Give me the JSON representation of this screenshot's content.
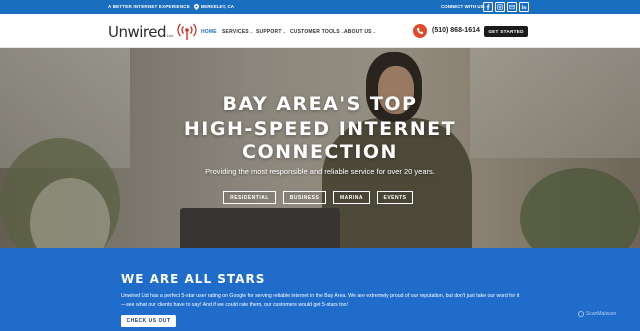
{
  "topbar": {
    "tagline": "A BETTER INTERNET EXPERIENCE",
    "location": "BERKELEY, CA",
    "connect": "CONNECT WITH US:",
    "social": [
      "facebook-icon",
      "instagram-icon",
      "email-icon",
      "linkedin-icon"
    ]
  },
  "nav": {
    "logo_word": "Unwired",
    "logo_suffix": "Ltd.",
    "items": [
      {
        "label": "HOME",
        "active": true
      },
      {
        "label": "SERVICES",
        "dropdown": true
      },
      {
        "label": "SUPPORT",
        "dropdown": true
      },
      {
        "label": "CUSTOMER TOOLS",
        "dropdown": true
      },
      {
        "label": "ABOUT US",
        "dropdown": true
      }
    ],
    "phone": "(510) 868-1614",
    "cta": "GET STARTED"
  },
  "hero": {
    "line1": "BAY AREA'S TOP",
    "line2": "HIGH-SPEED INTERNET",
    "line3": "CONNECTION",
    "subtitle": "Providing the most responsible and reliable service for over 20 years.",
    "buttons": [
      "RESIDENTIAL",
      "BUSINESS",
      "MARINA",
      "EVENTS"
    ]
  },
  "stars": {
    "heading": "WE ARE ALL STARS",
    "paragraph": "Unwired Ltd has a perfect 5-star user rating on Google for serving reliable internet in the Bay Area. We are extremely proud of our reputation, but don't just take our word for it—see what our clients have to say! And if we could rate them, our customers would get 5-stars too!",
    "cta": "CHECK US OUT",
    "watermark": "ScanMalware"
  },
  "colors": {
    "brand_blue": "#1a6ec0",
    "section_blue": "#1f6ccb",
    "phone_accent": "#e04a2c",
    "dark": "#1b1b1b"
  }
}
